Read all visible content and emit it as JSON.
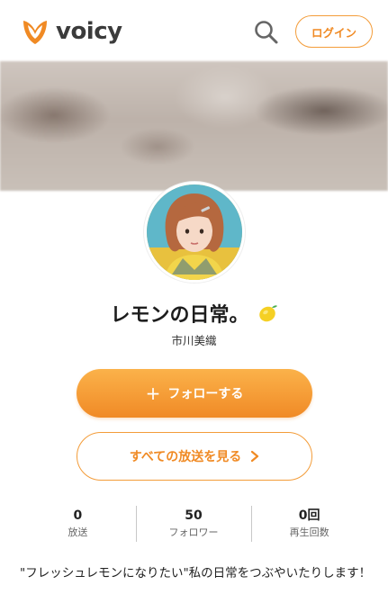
{
  "header": {
    "brand": "voicy",
    "login_label": "ログイン",
    "icons": {
      "logo": "voicy-logo-icon",
      "search": "search-icon"
    },
    "accent_color": "#f08a24"
  },
  "channel": {
    "title": "レモンの日常。",
    "title_icon": "lemon-icon",
    "personality": "市川美織",
    "follow_label": "フォローする",
    "all_broadcasts_label": "すべての放送を見る",
    "stats": [
      {
        "value": "0",
        "label": "放送"
      },
      {
        "value": "50",
        "label": "フォロワー"
      },
      {
        "value": "0回",
        "label": "再生回数"
      }
    ],
    "description": "\"フレッシュレモンになりたい\"私の日常をつぶやいたりします！"
  }
}
